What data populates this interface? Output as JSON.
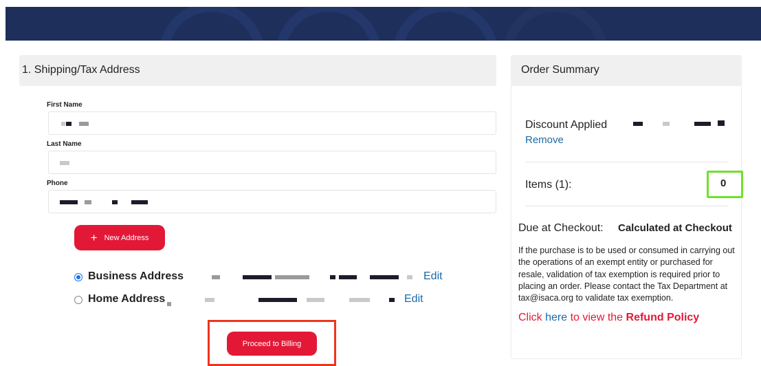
{
  "shipping": {
    "section_title": "1. Shipping/Tax Address",
    "first_name_label": "First Name",
    "last_name_label": "Last Name",
    "phone_label": "Phone",
    "new_address_label": "New Address",
    "new_address_icon": "plus-icon",
    "addresses": [
      {
        "name": "Business Address",
        "selected": true,
        "edit_label": "Edit"
      },
      {
        "name": "Home Address",
        "selected": false,
        "edit_label": "Edit"
      }
    ],
    "proceed_label": "Proceed to Billing"
  },
  "summary": {
    "title": "Order Summary",
    "discount_label": "Discount Applied",
    "remove_label": "Remove",
    "items_label": "Items (1):",
    "items_value": "0",
    "due_label": "Due at Checkout:",
    "due_value": "Calculated at Checkout",
    "tax_note": "If the purchase is to be used or consumed in carrying out the operations of an exempt entity or purchased for resale, validation of tax exemption is required prior to placing an order. Please contact the Tax Department at tax@isaca.org to validate tax exemption.",
    "refund_prefix": "Click ",
    "refund_link": "here",
    "refund_mid": " to view the ",
    "refund_policy": "Refund Policy"
  },
  "colors": {
    "banner": "#1e2f5c",
    "accent_red": "#e31837",
    "link_blue": "#1a6aa8",
    "highlight_red": "#f0331c",
    "highlight_green": "#6fe12a"
  }
}
